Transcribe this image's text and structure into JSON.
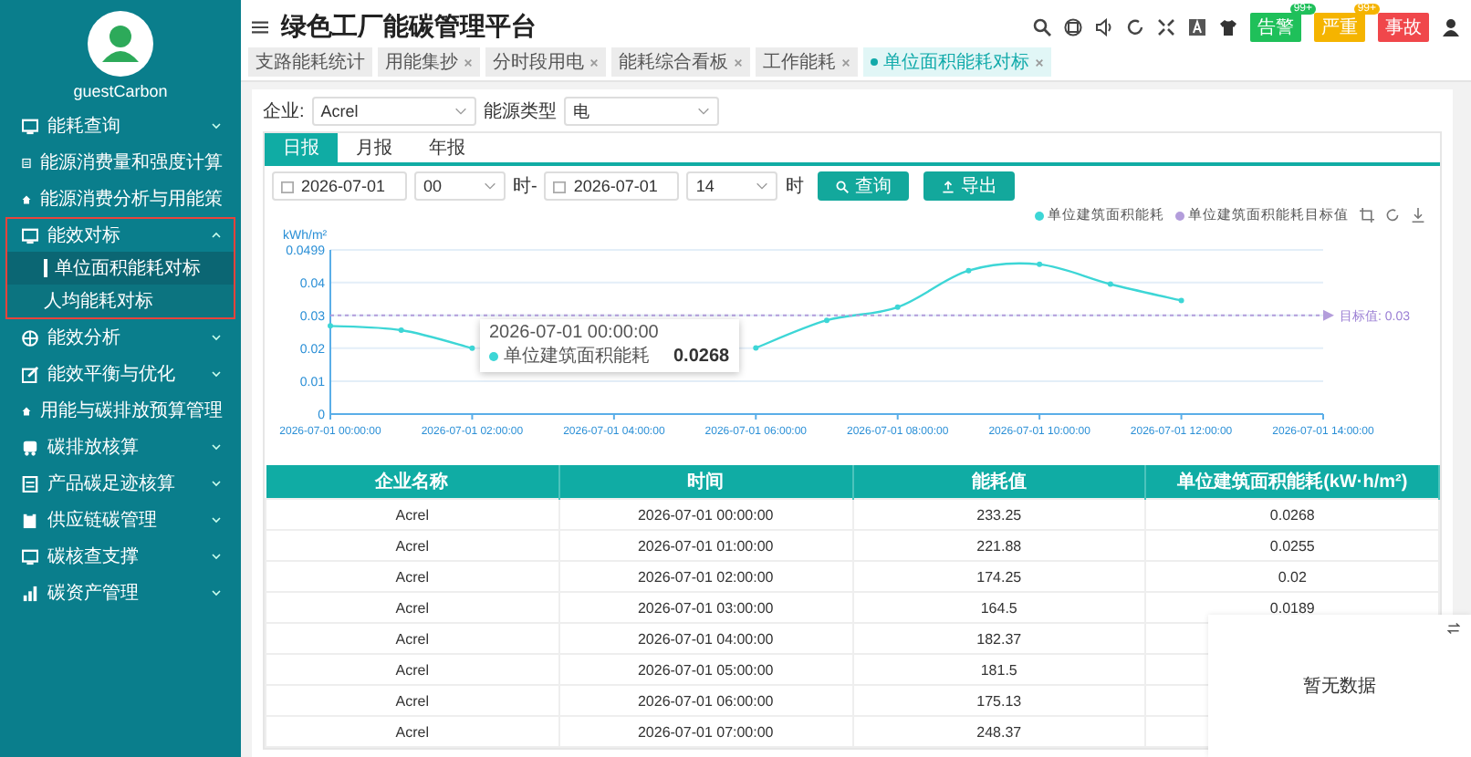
{
  "sidebar": {
    "user": "guestCarbon",
    "items": [
      {
        "label": "能耗查询",
        "expanded": false,
        "highlighted": false
      },
      {
        "label": "能源消费量和强度计算",
        "highlighted": false
      },
      {
        "label": "能源消费分析与用能策",
        "highlighted": false
      },
      {
        "label": "能效对标",
        "expanded": true,
        "highlighted": true,
        "children": [
          {
            "label": "单位面积能耗对标",
            "selected": true
          },
          {
            "label": "人均能耗对标",
            "selected": false
          }
        ]
      },
      {
        "label": "能效分析",
        "expanded": false,
        "highlighted": false
      },
      {
        "label": "能效平衡与优化",
        "expanded": false,
        "highlighted": false
      },
      {
        "label": "用能与碳排放预算管理",
        "highlighted": false
      },
      {
        "label": "碳排放核算",
        "expanded": false,
        "highlighted": false
      },
      {
        "label": "产品碳足迹核算",
        "expanded": false,
        "highlighted": false
      },
      {
        "label": "供应链碳管理",
        "expanded": false,
        "highlighted": false
      },
      {
        "label": "碳核查支撑",
        "expanded": false,
        "highlighted": false
      },
      {
        "label": "碳资产管理",
        "expanded": false,
        "highlighted": false
      }
    ]
  },
  "header": {
    "title": "绿色工厂能碳管理平台",
    "alerts": [
      {
        "label": "告警",
        "count": "99+",
        "color": "#1fc05a"
      },
      {
        "label": "严重",
        "count": "99+",
        "color": "#f5b400"
      },
      {
        "label": "事故",
        "color": "#f0474b"
      }
    ]
  },
  "tabs": [
    {
      "label": "支路能耗统计",
      "closable": false,
      "selected": false
    },
    {
      "label": "用能集抄",
      "closable": true,
      "selected": false
    },
    {
      "label": "分时段用电",
      "closable": true,
      "selected": false
    },
    {
      "label": "能耗综合看板",
      "closable": true,
      "selected": false
    },
    {
      "label": "工作能耗",
      "closable": true,
      "selected": false
    },
    {
      "label": "单位面积能耗对标",
      "closable": true,
      "selected": true
    }
  ],
  "filters": {
    "enterprise_label": "企业:",
    "enterprise": "Acrel",
    "energy_label": "能源类型",
    "energy": "电"
  },
  "report_tabs": [
    {
      "label": "日报",
      "selected": true
    },
    {
      "label": "月报",
      "selected": false
    },
    {
      "label": "年报",
      "selected": false
    }
  ],
  "query": {
    "start_date": "2026-07-01",
    "start_hour": "00",
    "separator": "时-",
    "end_date": "2026-07-01",
    "end_hour": "14",
    "suffix": "时",
    "buttons": [
      {
        "label": "查询",
        "kind": "search"
      },
      {
        "label": "导出",
        "kind": "export"
      }
    ]
  },
  "chart": {
    "chart_data": {
      "type": "line",
      "ylabel": "kWh/m²",
      "categories": [
        "2026-07-01 00:00:00",
        null,
        "2026-07-01 02:00:00",
        null,
        "2026-07-01 04:00:00",
        null,
        "2026-07-01 06:00:00",
        null,
        "2026-07-01 08:00:00",
        null,
        "2026-07-01 10:00:00",
        null,
        "2026-07-01 12:00:00",
        null,
        "2026-07-01 14:00:00"
      ],
      "series": [
        {
          "name": "单位建筑面积能耗",
          "color": "#3dd6d6",
          "marker": "circle",
          "values": [
            0.0268,
            0.0255,
            0.02,
            null,
            null,
            null,
            0.0201,
            0.0285,
            0.0325,
            0.0436,
            0.0455,
            0.0395,
            0.0345,
            null,
            null
          ]
        },
        {
          "name": "单位建筑面积能耗目标值",
          "color": "#b39ddb",
          "line_style": "dashed",
          "values": [
            0.03,
            0.03,
            0.03,
            0.03,
            0.03,
            0.03,
            0.03,
            0.03,
            0.03,
            0.03,
            0.03,
            0.03,
            0.03,
            0.03,
            0.03
          ]
        }
      ],
      "grid": true,
      "legend": "top right",
      "ylim": [
        0,
        0.0499
      ],
      "yticks": [
        0,
        0.01,
        0.02,
        0.03,
        0.04,
        0.0499
      ],
      "annotations": [
        "目标值: 0.03"
      ]
    },
    "tooltip": {
      "title": "2026-07-01 00:00:00",
      "series": "单位建筑面积能耗",
      "value": "0.0268"
    }
  },
  "table": {
    "columns": [
      "企业名称",
      "时间",
      "能耗值",
      "单位建筑面积能耗(kW·h/m²)"
    ],
    "rows": [
      [
        "Acrel",
        "2026-07-01 00:00:00",
        "233.25",
        "0.0268"
      ],
      [
        "Acrel",
        "2026-07-01 01:00:00",
        "221.88",
        "0.0255"
      ],
      [
        "Acrel",
        "2026-07-01 02:00:00",
        "174.25",
        "0.02"
      ],
      [
        "Acrel",
        "2026-07-01 03:00:00",
        "164.5",
        "0.0189"
      ],
      [
        "Acrel",
        "2026-07-01 04:00:00",
        "182.37"
      ],
      [
        "Acrel",
        "2026-07-01 05:00:00",
        "181.5"
      ],
      [
        "Acrel",
        "2026-07-01 06:00:00",
        "175.13"
      ],
      [
        "Acrel",
        "2026-07-01 07:00:00",
        "248.37"
      ]
    ]
  },
  "empty_panel": {
    "message": "暂无数据"
  }
}
